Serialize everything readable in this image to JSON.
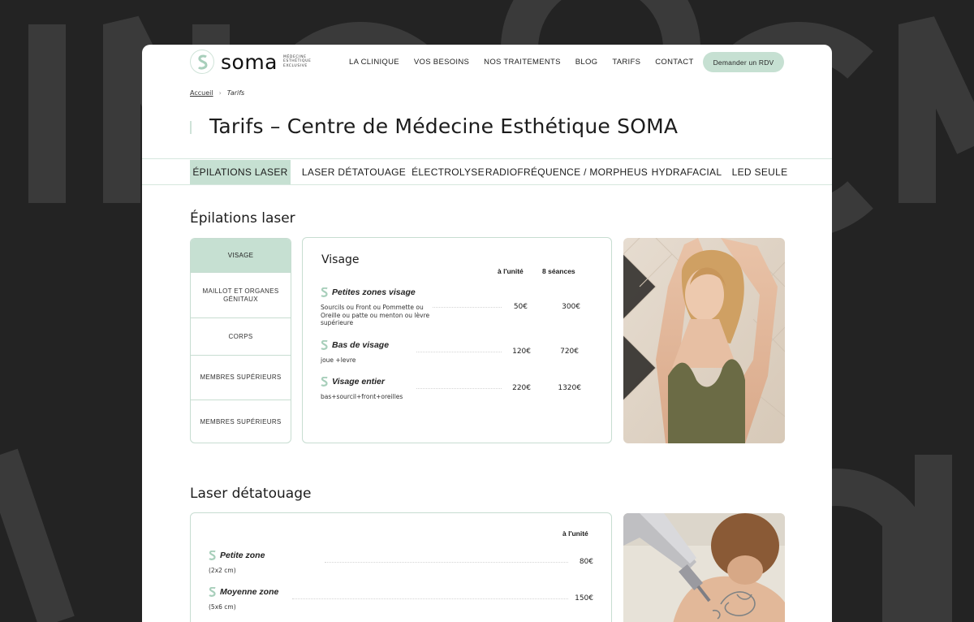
{
  "background": {
    "letters_top": "INCDCN",
    "letters_bottom": "NCDA"
  },
  "header": {
    "logo": {
      "word": "soma",
      "tagline": [
        "Médecine",
        "Esthétique",
        "Exclusive"
      ]
    },
    "nav": [
      "LA CLINIQUE",
      "VOS BESOINS",
      "NOS TRAITEMENTS",
      "BLOG",
      "TARIFS",
      "CONTACT"
    ],
    "cta_label": "Demander un RDV"
  },
  "breadcrumb": {
    "home": "Accueil",
    "current": "Tarifs"
  },
  "page_title": "Tarifs – Centre de Médecine Esthétique SOMA",
  "tabs": [
    {
      "label": "ÉPILATIONS LASER",
      "active": true
    },
    {
      "label": "LASER DÉTATOUAGE",
      "active": false
    },
    {
      "label": "ÉLECTROLYSE",
      "active": false
    },
    {
      "label": "RADIOFRÉQUENCE / MORPHEUS",
      "active": false
    },
    {
      "label": "HYDRAFACIAL",
      "active": false
    },
    {
      "label": "LED SEULE",
      "active": false
    }
  ],
  "epilation": {
    "section_title": "Épilations laser",
    "menu": [
      "VISAGE",
      "MAILLOT ET ORGANES GÉNITAUX",
      "CORPS",
      "MEMBRES SUPÉRIEURS",
      "MEMBRES SUPÉRIEURS"
    ],
    "card": {
      "title": "Visage",
      "col_unit": "à l'unité",
      "col_sessions": "8 séances",
      "rows": [
        {
          "name": "Petites zones visage",
          "desc": "Sourcils ou Front ou  Pommette ou Oreille ou patte ou menton ou lèvre supérieure",
          "unit": "50€",
          "sessions": "300€"
        },
        {
          "name": "Bas de visage",
          "desc": "joue +levre",
          "unit": "120€",
          "sessions": "720€"
        },
        {
          "name": "Visage entier",
          "desc": "bas+sourcil+front+oreilles",
          "unit": "220€",
          "sessions": "1320€"
        }
      ]
    }
  },
  "detatouage": {
    "section_title": "Laser détatouage",
    "card": {
      "col_unit": "à l'unité",
      "rows": [
        {
          "name": "Petite zone",
          "desc": "(2x2 cm)",
          "unit": "80€"
        },
        {
          "name": "Moyenne zone",
          "desc": "(5x6 cm)",
          "unit": "150€"
        }
      ]
    }
  },
  "colors": {
    "accent": "#c6e0d2",
    "border": "#c7ddd1",
    "background": "#232323"
  }
}
